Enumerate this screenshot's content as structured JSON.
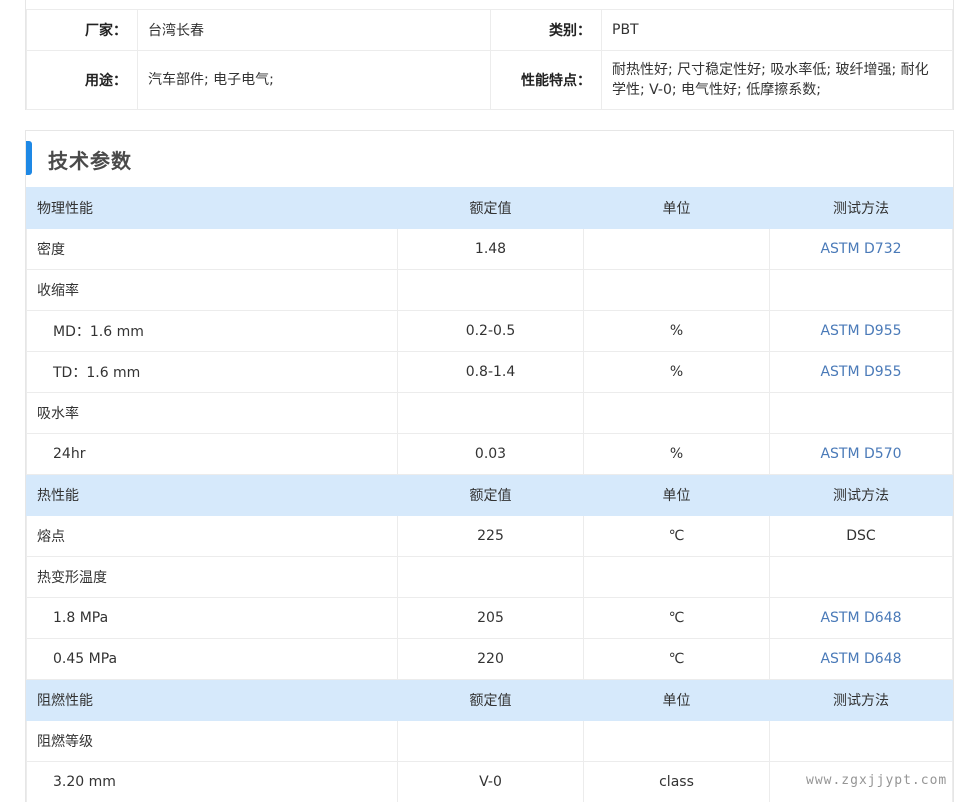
{
  "info": {
    "manufacturer_label": "厂家：",
    "manufacturer": "台湾长春",
    "category_label": "类别：",
    "category": "PBT",
    "usage_label": "用途：",
    "usage": "汽车部件; 电子电气;",
    "features_label": "性能特点：",
    "features": "耐热性好; 尺寸稳定性好; 吸水率低; 玻纤增强; 耐化学性; V-0; 电气性好; 低摩擦系数;"
  },
  "section_title": "技术参数",
  "columns": {
    "rated": "额定值",
    "unit": "单位",
    "method": "测试方法"
  },
  "groups": [
    {
      "name": "物理性能",
      "rows": [
        {
          "name": "密度",
          "value": "1.48",
          "unit": "",
          "method": "ASTM D732",
          "indent": false,
          "link": true
        },
        {
          "name": "收缩率",
          "value": "",
          "unit": "",
          "method": "",
          "indent": false,
          "link": false
        },
        {
          "name": "MD：1.6 mm",
          "value": "0.2-0.5",
          "unit": "%",
          "method": "ASTM D955",
          "indent": true,
          "link": true
        },
        {
          "name": "TD：1.6 mm",
          "value": "0.8-1.4",
          "unit": "%",
          "method": "ASTM D955",
          "indent": true,
          "link": true
        },
        {
          "name": "吸水率",
          "value": "",
          "unit": "",
          "method": "",
          "indent": false,
          "link": false
        },
        {
          "name": "24hr",
          "value": "0.03",
          "unit": "%",
          "method": "ASTM D570",
          "indent": true,
          "link": true
        }
      ]
    },
    {
      "name": "热性能",
      "rows": [
        {
          "name": "熔点",
          "value": "225",
          "unit": "℃",
          "method": "DSC",
          "indent": false,
          "link": false
        },
        {
          "name": "热变形温度",
          "value": "",
          "unit": "",
          "method": "",
          "indent": false,
          "link": false
        },
        {
          "name": "1.8 MPa",
          "value": "205",
          "unit": "℃",
          "method": "ASTM D648",
          "indent": true,
          "link": true
        },
        {
          "name": "0.45 MPa",
          "value": "220",
          "unit": "℃",
          "method": "ASTM D648",
          "indent": true,
          "link": true
        }
      ]
    },
    {
      "name": "阻燃性能",
      "rows": [
        {
          "name": "阻燃等级",
          "value": "",
          "unit": "",
          "method": "",
          "indent": false,
          "link": false
        },
        {
          "name": "3.20 mm",
          "value": "V-0",
          "unit": "class",
          "method": "",
          "indent": true,
          "link": false
        }
      ]
    }
  ],
  "watermark": "www.zgxjjypt.com",
  "colors": {
    "accent": "#1e88e5",
    "group_bg": "#d6e9fb",
    "link": "#4a7ab8"
  }
}
